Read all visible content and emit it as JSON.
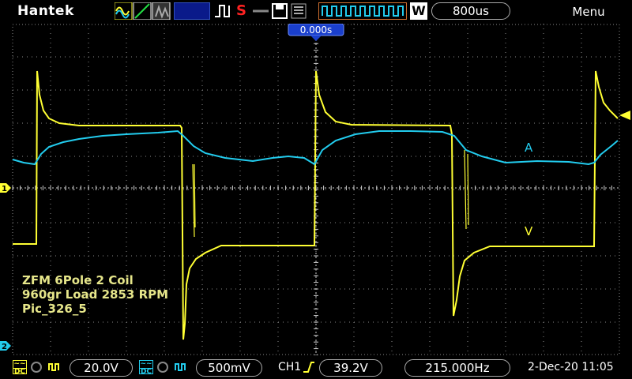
{
  "top_bar": {
    "brand": "Hantek",
    "trigger_status": "S",
    "timebase_mode": "W",
    "timebase": "800us",
    "menu_label": "Menu"
  },
  "screen": {
    "trigger_position_label": "0.000s",
    "ch1_marker": "1",
    "ch2_marker": "2",
    "trace_label_current": "A",
    "trace_label_voltage": "V",
    "annotation": [
      "ZFM 6Pole 2 Coil",
      "960gr Load 2853 RPM",
      "Pic_326_5"
    ],
    "colors": {
      "ch1": "#ffff33",
      "ch2": "#22ccee",
      "grid": "#8a8a8a",
      "annotation": "#e6e68a"
    }
  },
  "bottom_bar": {
    "ch1_coupling": "DC",
    "ch1_scale": "20.0V",
    "ch2_coupling": "DC",
    "ch2_scale": "500mV",
    "trigger_source": "CH1",
    "trigger_level": "39.2V",
    "frequency": "215.000Hz",
    "datetime": "2-Dec-20 11:05"
  }
}
